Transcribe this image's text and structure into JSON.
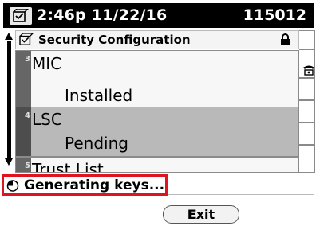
{
  "header": {
    "datetime": "2:46p 11/22/16",
    "extension": "115012",
    "app_icon": "settings-checklist-icon"
  },
  "screen": {
    "title": "Security Configuration",
    "title_icon": "settings-checklist-icon",
    "lock_icon": "lock-icon"
  },
  "items": [
    {
      "index": "3",
      "label": "MIC",
      "value": "Installed"
    },
    {
      "index": "4",
      "label": "LSC",
      "value": "Pending"
    },
    {
      "index": "5",
      "label": "Trust List"
    }
  ],
  "line_keys": {
    "icon": "phone-handset-icon"
  },
  "status": {
    "icon": "progress-clock-icon",
    "text": "Generating keys..."
  },
  "softkeys": {
    "exit": "Exit"
  },
  "colors": {
    "highlight": "#e0141e",
    "selected_row": "#b9b9b9"
  }
}
